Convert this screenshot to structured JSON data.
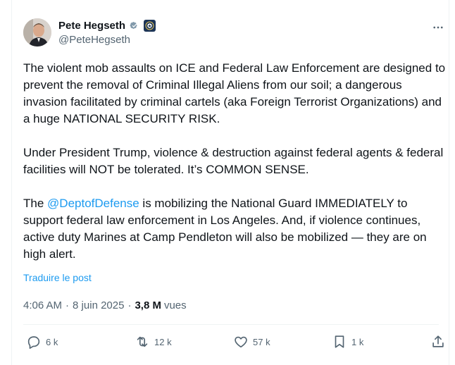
{
  "author": {
    "name": "Pete Hegseth",
    "handle": "@PeteHegseth"
  },
  "post": {
    "paragraphs": [
      {
        "before": "The violent mob assaults on ICE and Federal Law Enforcement are designed to prevent the removal of Criminal Illegal Aliens from our soil; a dangerous invasion facilitated by criminal cartels (aka Foreign Terrorist Organizations) and a huge NATIONAL SECURITY RISK."
      },
      {
        "before": "Under President Trump, violence & destruction against federal agents & federal facilities will NOT be tolerated. It’s COMMON SENSE."
      },
      {
        "before": "The ",
        "mention": "@DeptofDefense",
        "after": " is mobilizing the National Guard IMMEDIATELY to support federal law enforcement in Los Angeles. And, if violence continues, active duty Marines at Camp Pendleton will also be mobilized — they are on high alert."
      }
    ],
    "translate_label": "Traduire le post",
    "time": "4:06 AM",
    "separator": "·",
    "date": "8 juin 2025",
    "views_count": "3,8 M",
    "views_label": "vues"
  },
  "actions": {
    "replies": "6 k",
    "reposts": "12 k",
    "likes": "57 k",
    "bookmarks": "1 k"
  },
  "icons": {
    "verified": "verified-badge-icon",
    "affiliation": "government-affiliation-icon",
    "more": "more-icon",
    "reply": "reply-icon",
    "repost": "repost-icon",
    "like": "heart-icon",
    "bookmark": "bookmark-icon",
    "share": "share-icon"
  },
  "colors": {
    "accent": "#1d9bf0",
    "text": "#0f1419",
    "muted": "#536471"
  }
}
